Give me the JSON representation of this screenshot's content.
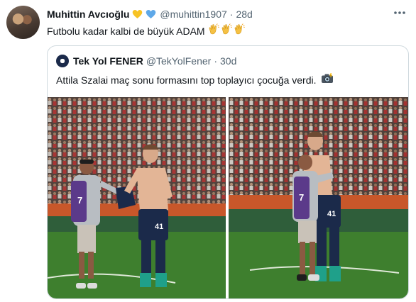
{
  "tweet": {
    "author_name": "Muhittin Avcıoğlu",
    "author_badges": [
      "yellow-heart-icon",
      "blue-heart-icon"
    ],
    "handle": "@muhittin1907",
    "separator": "·",
    "time": "28d",
    "more_icon": "more-icon",
    "text": "Futbolu kadar kalbi de büyük ADAM",
    "emoji": [
      "clapping-hands-icon",
      "clapping-hands-icon",
      "clapping-hands-icon"
    ]
  },
  "quoted_tweet": {
    "author_name": "Tek Yol FENER",
    "handle": "@TekYolFener",
    "separator": "·",
    "time": "30d",
    "text": "Attila Szalai maç sonu formasını top toplayıcı çocuğa verdi.",
    "emoji": "camera-flash-icon",
    "photos": [
      {
        "name": "photo-jersey-handover",
        "player_number": "41",
        "kid_number": "7"
      },
      {
        "name": "photo-hug",
        "player_number": "41",
        "kid_number": "7"
      }
    ]
  },
  "colors": {
    "text_primary": "#0f1419",
    "text_secondary": "#536471",
    "border": "#cfd9de",
    "pitch_green": "#3e7f2e",
    "kit_navy": "#1b2a4a",
    "bib_purple": "#5b3a8a"
  }
}
